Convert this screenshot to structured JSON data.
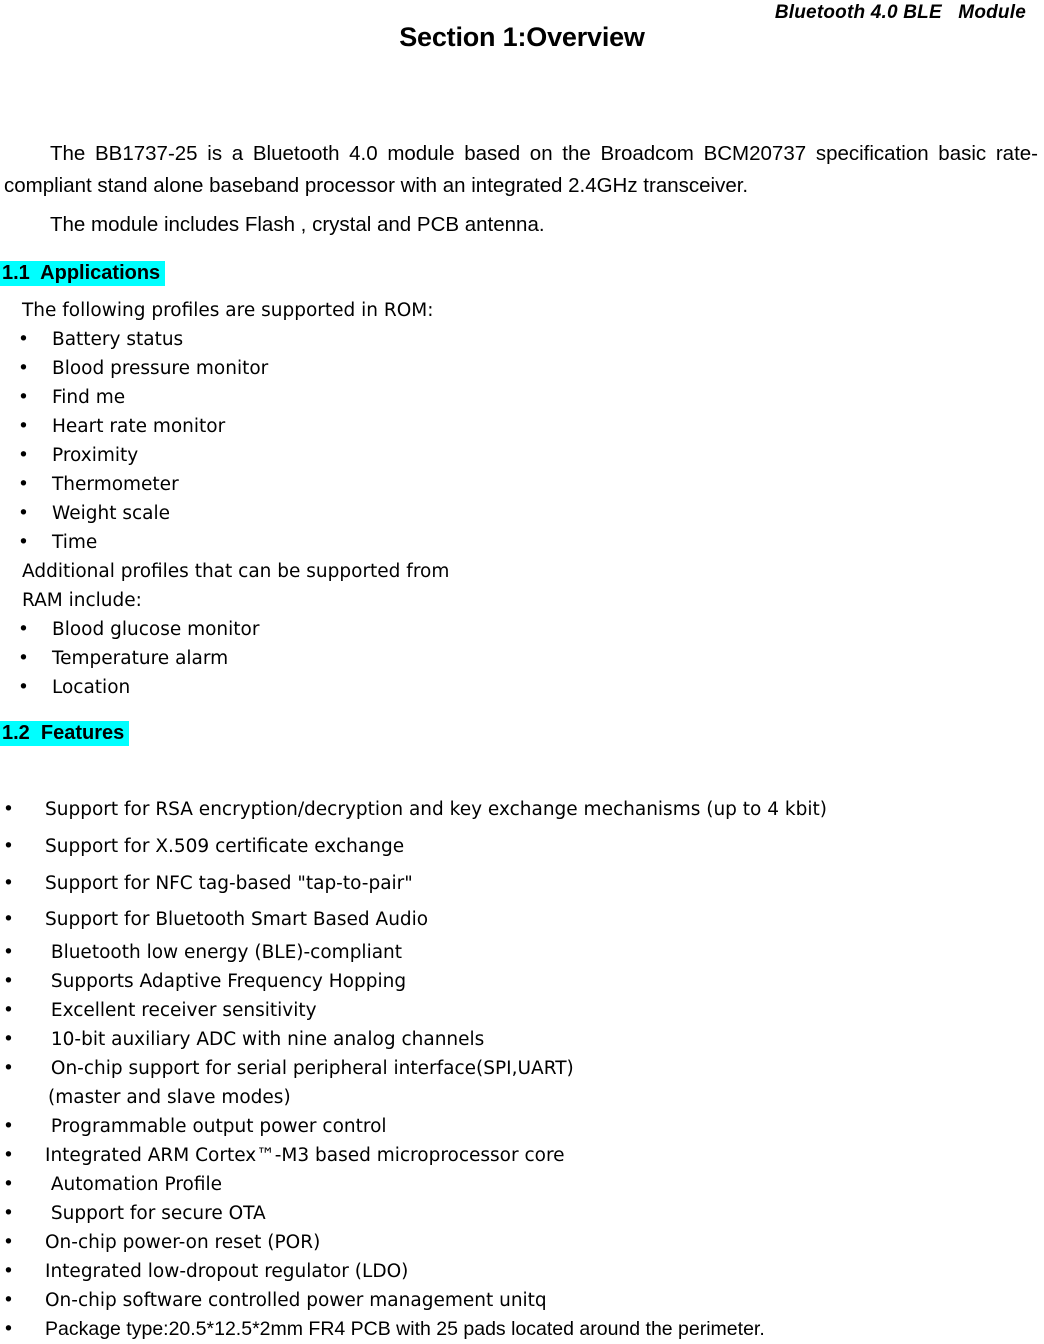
{
  "header": {
    "running_title": "Bluetooth 4.0 BLE   Module"
  },
  "section": {
    "title": "Section 1:Overview"
  },
  "intro": {
    "paragraph_1": "The BB1737-25 is a Bluetooth 4.0 module based on the Broadcom BCM20737 specification basic rate-compliant stand alone baseband processor with an integrated 2.4GHz transceiver.",
    "paragraph_2": "The module includes Flash , crystal and PCB antenna."
  },
  "applications": {
    "heading_number": "1.1",
    "heading_text": "Applications",
    "heading_full": "1.1  Applications",
    "lead_in": "The following profiles are supported in ROM:",
    "bullet_glyph": "•",
    "rom_profiles": [
      "Battery status",
      "Blood pressure monitor",
      "Find me",
      "Heart rate monitor",
      "Proximity",
      "Thermometer",
      "Weight scale",
      "Time"
    ],
    "ram_lead_in_line_1": "Additional profiles that can be supported from",
    "ram_lead_in_line_2": "RAM include:",
    "ram_profiles": [
      "Blood glucose monitor",
      "Temperature alarm",
      "Location"
    ]
  },
  "features": {
    "heading_number": "1.2",
    "heading_text": "Features",
    "heading_full": "1.2  Features",
    "bullet_glyph": "•",
    "items": [
      "Support for RSA encryption/decryption and key exchange mechanisms (up to 4 kbit)",
      "Support for X.509 certificate exchange",
      "Support for NFC tag-based \"tap-to-pair\"",
      "Support for Bluetooth Smart Based Audio",
      " Bluetooth low energy (BLE)-compliant",
      " Supports Adaptive Frequency Hopping",
      " Excellent receiver sensitivity",
      " 10-bit auxiliary ADC with nine analog channels",
      " On-chip support for serial peripheral interface(SPI,UART)",
      " Programmable output power control",
      "Integrated ARM Cortex™-M3 based microprocessor core",
      " Automation Profile",
      " Support for secure OTA",
      "On-chip power-on reset (POR)",
      "Integrated low-dropout regulator (LDO)",
      "On-chip software controlled power management unitq",
      "Package type:20.5*12.5*2mm FR4 PCB with 25 pads located around the perimeter."
    ],
    "spi_continuation": "(master and slave modes)"
  },
  "colors": {
    "highlight": "#00ffff",
    "text": "#000000",
    "page_background": "#ffffff"
  }
}
